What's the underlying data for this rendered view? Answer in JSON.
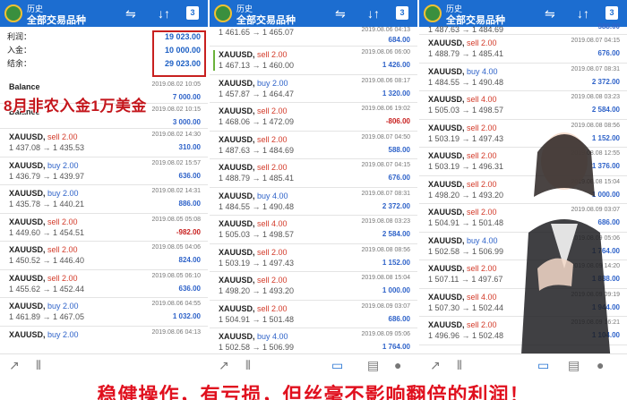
{
  "header": {
    "history": "历史",
    "title": "全部交易品种",
    "calendar_day": "3"
  },
  "summary": {
    "profit_label": "利润：",
    "profit": "19 023.00",
    "deposit_label": "入金：",
    "deposit": "10 000.00",
    "balance_label": "结余：",
    "balance": "29 023.00"
  },
  "banner_top": "8月非农入金1万美金",
  "banner_bottom": "稳健操作，有亏损，但丝毫不影响翻倍的利润！",
  "panel1": {
    "balances": [
      {
        "label": "Balance",
        "date": "2019.08.02 10:05",
        "amount": "7 000.00"
      },
      {
        "label": "Balance",
        "date": "2019.08.02 10:15",
        "amount": "3 000.00"
      }
    ],
    "trades": [
      {
        "sym": "XAUUSD,",
        "side": "sell 2.00",
        "type": "sell",
        "prices": "1 437.08 → 1 435.53",
        "date": "2019.08.02 14:30",
        "pl": "310.00",
        "neg": false
      },
      {
        "sym": "XAUUSD,",
        "side": "buy 2.00",
        "type": "buy",
        "prices": "1 436.79 → 1 439.97",
        "date": "2019.08.02 15:57",
        "pl": "636.00",
        "neg": false
      },
      {
        "sym": "XAUUSD,",
        "side": "buy 2.00",
        "type": "buy",
        "prices": "1 435.78 → 1 440.21",
        "date": "2019.08.02 14:31",
        "pl": "886.00",
        "neg": false
      },
      {
        "sym": "XAUUSD,",
        "side": "sell 2.00",
        "type": "sell",
        "prices": "1 449.60 → 1 454.51",
        "date": "2019.08.05 05:08",
        "pl": "-982.00",
        "neg": true
      },
      {
        "sym": "XAUUSD,",
        "side": "sell 2.00",
        "type": "sell",
        "prices": "1 450.52 → 1 446.40",
        "date": "2019.08.05 04:06",
        "pl": "824.00",
        "neg": false
      },
      {
        "sym": "XAUUSD,",
        "side": "sell 2.00",
        "type": "sell",
        "prices": "1 455.62 → 1 452.44",
        "date": "2019.08.05 06:10",
        "pl": "636.00",
        "neg": false
      },
      {
        "sym": "XAUUSD,",
        "side": "buy 2.00",
        "type": "buy",
        "prices": "1 461.89 → 1 467.05",
        "date": "2019.08.06 04:55",
        "pl": "1 032.00",
        "neg": false
      },
      {
        "sym": "XAUUSD,",
        "side": "buy 2.00",
        "type": "buy",
        "prices": "",
        "date": "2019.08.06 04:13",
        "pl": "",
        "neg": false
      }
    ]
  },
  "panel2": {
    "top": {
      "prices": "1 461.65 → 1 465.07",
      "date": "2019.08.06 04:13",
      "pl": "684.00"
    },
    "trades": [
      {
        "sym": "XAUUSD,",
        "side": "sell 2.00",
        "type": "sell",
        "prices": "1 467.13 → 1 460.00",
        "date": "2019.08.06 06:00",
        "pl": "1 426.00",
        "neg": false
      },
      {
        "sym": "XAUUSD,",
        "side": "buy 2.00",
        "type": "buy",
        "prices": "1 457.87 → 1 464.47",
        "date": "2019.08.06 08:17",
        "pl": "1 320.00",
        "neg": false
      },
      {
        "sym": "XAUUSD,",
        "side": "sell 2.00",
        "type": "sell",
        "prices": "1 468.06 → 1 472.09",
        "date": "2019.08.06 19:02",
        "pl": "-806.00",
        "neg": true
      },
      {
        "sym": "XAUUSD,",
        "side": "sell 2.00",
        "type": "sell",
        "prices": "1 487.63 → 1 484.69",
        "date": "2019.08.07 04:50",
        "pl": "588.00",
        "neg": false
      },
      {
        "sym": "XAUUSD,",
        "side": "sell 2.00",
        "type": "sell",
        "prices": "1 488.79 → 1 485.41",
        "date": "2019.08.07 04:15",
        "pl": "676.00",
        "neg": false
      },
      {
        "sym": "XAUUSD,",
        "side": "buy 4.00",
        "type": "buy",
        "prices": "1 484.55 → 1 490.48",
        "date": "2019.08.07 08:31",
        "pl": "2 372.00",
        "neg": false
      },
      {
        "sym": "XAUUSD,",
        "side": "sell 4.00",
        "type": "sell",
        "prices": "1 505.03 → 1 498.57",
        "date": "2019.08.08 03:23",
        "pl": "2 584.00",
        "neg": false
      },
      {
        "sym": "XAUUSD,",
        "side": "sell 2.00",
        "type": "sell",
        "prices": "1 503.19 → 1 497.43",
        "date": "2019.08.08 08:56",
        "pl": "1 152.00",
        "neg": false
      },
      {
        "sym": "XAUUSD,",
        "side": "sell 2.00",
        "type": "sell",
        "prices": "1 498.20 → 1 493.20",
        "date": "2019.08.08 15:04",
        "pl": "1 000.00",
        "neg": false
      },
      {
        "sym": "XAUUSD,",
        "side": "sell 2.00",
        "type": "sell",
        "prices": "1 504.91 → 1 501.48",
        "date": "2019.08.09 03:07",
        "pl": "686.00",
        "neg": false
      },
      {
        "sym": "XAUUSD,",
        "side": "buy 4.00",
        "type": "buy",
        "prices": "1 502.58 → 1 506.99",
        "date": "2019.08.09 05:06",
        "pl": "1 764.00",
        "neg": false
      }
    ]
  },
  "panel3": {
    "top": {
      "prices": "1 487.63 → 1 484.69",
      "date": "",
      "pl": "588.00"
    },
    "trades": [
      {
        "sym": "XAUUSD,",
        "side": "sell 2.00",
        "type": "sell",
        "prices": "1 488.79 → 1 485.41",
        "date": "2019.08.07 04:15",
        "pl": "676.00",
        "neg": false
      },
      {
        "sym": "XAUUSD,",
        "side": "buy 4.00",
        "type": "buy",
        "prices": "1 484.55 → 1 490.48",
        "date": "2019.08.07 08:31",
        "pl": "2 372.00",
        "neg": false
      },
      {
        "sym": "XAUUSD,",
        "side": "sell 4.00",
        "type": "sell",
        "prices": "1 505.03 → 1 498.57",
        "date": "2019.08.08 03:23",
        "pl": "2 584.00",
        "neg": false
      },
      {
        "sym": "XAUUSD,",
        "side": "sell 2.00",
        "type": "sell",
        "prices": "1 503.19 → 1 497.43",
        "date": "2019.08.08 08:56",
        "pl": "1 152.00",
        "neg": false
      },
      {
        "sym": "XAUUSD,",
        "side": "sell 2.00",
        "type": "sell",
        "prices": "1 503.19 → 1 496.31",
        "date": "2019.08.08 12:55",
        "pl": "1 376.00",
        "neg": false
      },
      {
        "sym": "XAUUSD,",
        "side": "sell 2.00",
        "type": "sell",
        "prices": "1 498.20 → 1 493.20",
        "date": "2019.08.08 15:04",
        "pl": "1 000.00",
        "neg": false
      },
      {
        "sym": "XAUUSD,",
        "side": "sell 2.00",
        "type": "sell",
        "prices": "1 504.91 → 1 501.48",
        "date": "2019.08.09 03:07",
        "pl": "686.00",
        "neg": false
      },
      {
        "sym": "XAUUSD,",
        "side": "buy 4.00",
        "type": "buy",
        "prices": "1 502.58 → 1 506.99",
        "date": "2019.08.09 05:06",
        "pl": "1 764.00",
        "neg": false
      },
      {
        "sym": "XAUUSD,",
        "side": "sell 2.00",
        "type": "sell",
        "prices": "1 507.11 → 1 497.67",
        "date": "2019.08.09 14:20",
        "pl": "1 888.00",
        "neg": false
      },
      {
        "sym": "XAUUSD,",
        "side": "sell 4.00",
        "type": "sell",
        "prices": "1 507.30 → 1 502.44",
        "date": "2019.08.09 09:19",
        "pl": "1 944.00",
        "neg": false
      },
      {
        "sym": "XAUUSD,",
        "side": "sell 2.00",
        "type": "sell",
        "prices": "1 496.96 → 1 502.48",
        "date": "2019.08.09 16:21",
        "pl": "1 104.00",
        "neg": false
      }
    ]
  }
}
